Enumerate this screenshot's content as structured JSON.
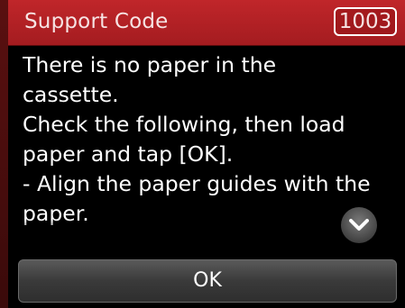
{
  "header": {
    "title": "Support Code",
    "code": "1003"
  },
  "message": {
    "lines": [
      "There is no paper in the",
      "cassette.",
      "Check the following, then load",
      "paper and tap [OK].",
      "- Align the paper guides with the",
      "paper."
    ]
  },
  "scroll": {
    "icon": "chevron-down-icon"
  },
  "footer": {
    "ok_label": "OK"
  },
  "colors": {
    "header_red": "#b32024",
    "background": "#000000",
    "button_gray": "#3a3a3a"
  }
}
